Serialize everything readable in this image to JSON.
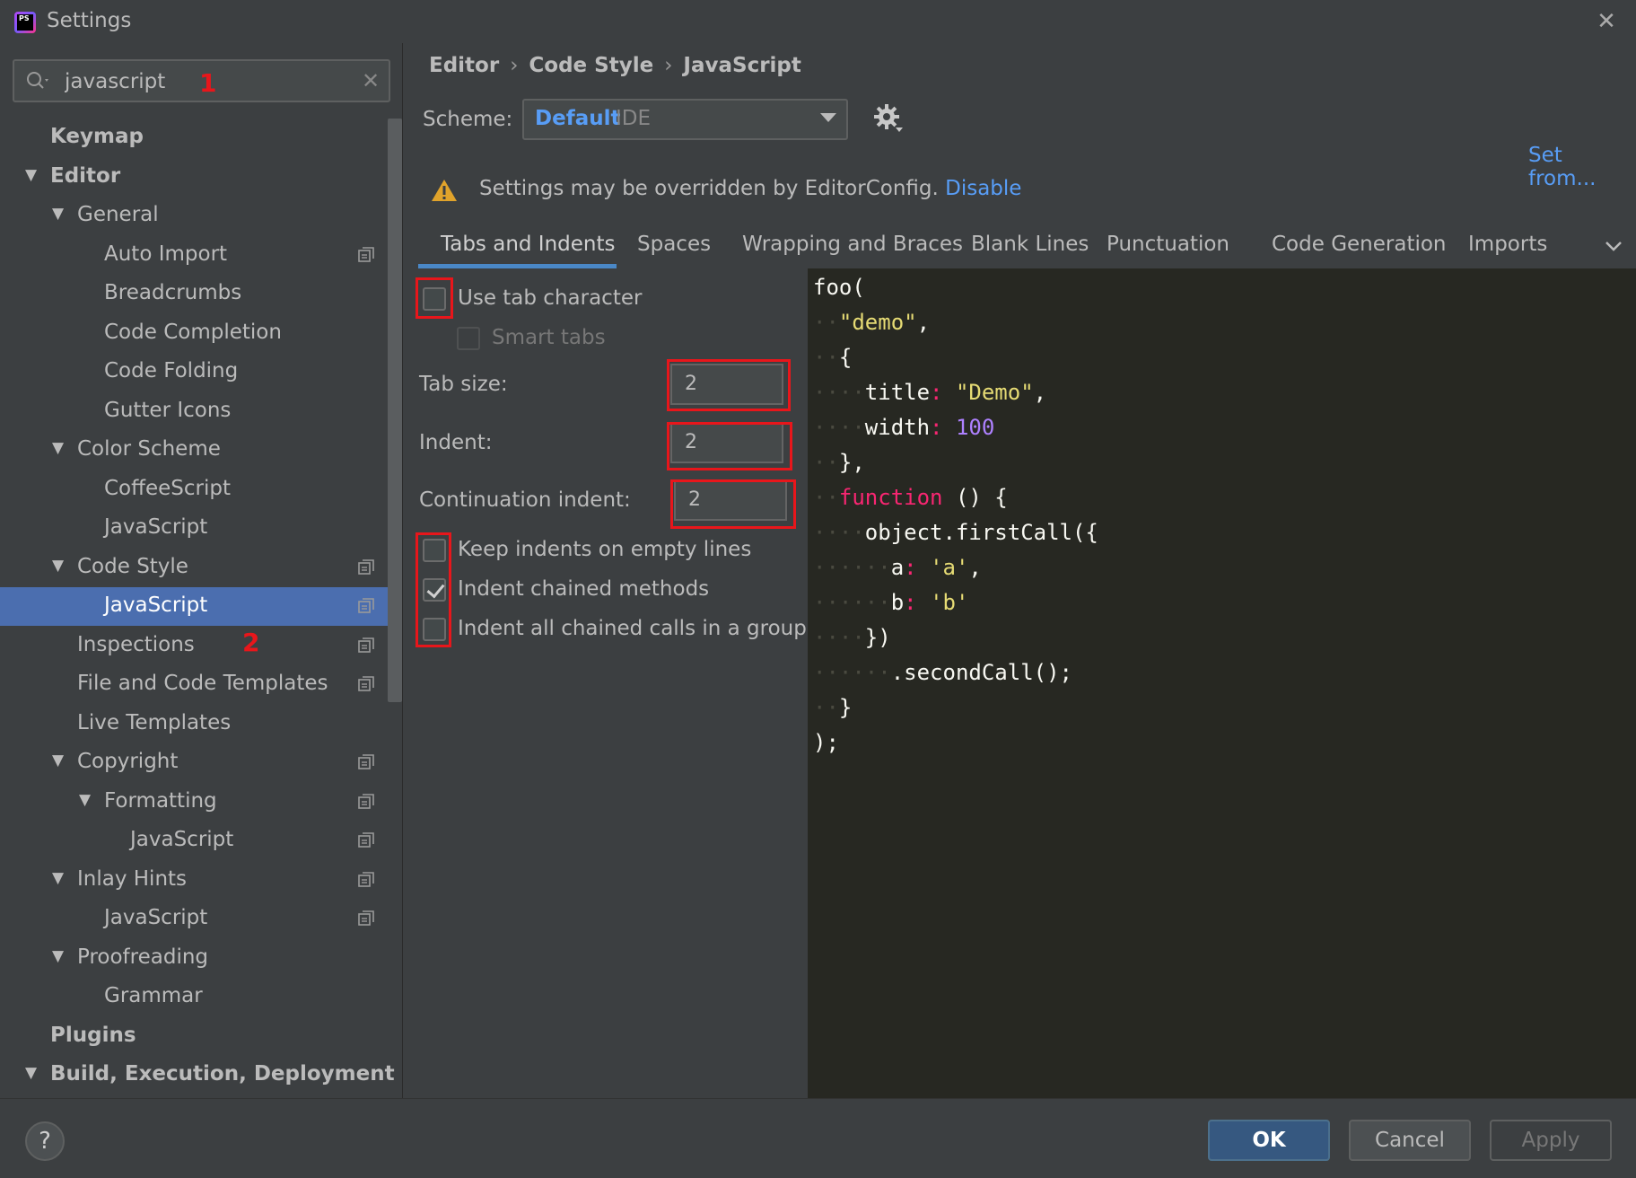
{
  "window": {
    "title": "Settings"
  },
  "search": {
    "value": "javascript",
    "annotation": "1"
  },
  "sidebar": {
    "selected_annotation": "2",
    "items": [
      {
        "label": "Keymap",
        "level": 0,
        "bold": true,
        "arrow": false,
        "copy": false,
        "selected": false
      },
      {
        "label": "Editor",
        "level": 0,
        "bold": true,
        "arrow": true,
        "copy": false,
        "selected": false
      },
      {
        "label": "General",
        "level": 1,
        "bold": false,
        "arrow": true,
        "copy": false,
        "selected": false
      },
      {
        "label": "Auto Import",
        "level": 2,
        "bold": false,
        "arrow": false,
        "copy": true,
        "selected": false
      },
      {
        "label": "Breadcrumbs",
        "level": 2,
        "bold": false,
        "arrow": false,
        "copy": false,
        "selected": false
      },
      {
        "label": "Code Completion",
        "level": 2,
        "bold": false,
        "arrow": false,
        "copy": false,
        "selected": false
      },
      {
        "label": "Code Folding",
        "level": 2,
        "bold": false,
        "arrow": false,
        "copy": false,
        "selected": false
      },
      {
        "label": "Gutter Icons",
        "level": 2,
        "bold": false,
        "arrow": false,
        "copy": false,
        "selected": false
      },
      {
        "label": "Color Scheme",
        "level": 1,
        "bold": false,
        "arrow": true,
        "copy": false,
        "selected": false
      },
      {
        "label": "CoffeeScript",
        "level": 2,
        "bold": false,
        "arrow": false,
        "copy": false,
        "selected": false
      },
      {
        "label": "JavaScript",
        "level": 2,
        "bold": false,
        "arrow": false,
        "copy": false,
        "selected": false
      },
      {
        "label": "Code Style",
        "level": 1,
        "bold": false,
        "arrow": true,
        "copy": true,
        "selected": false
      },
      {
        "label": "JavaScript",
        "level": 2,
        "bold": false,
        "arrow": false,
        "copy": true,
        "selected": true
      },
      {
        "label": "Inspections",
        "level": 1,
        "bold": false,
        "arrow": false,
        "copy": true,
        "selected": false
      },
      {
        "label": "File and Code Templates",
        "level": 1,
        "bold": false,
        "arrow": false,
        "copy": true,
        "selected": false
      },
      {
        "label": "Live Templates",
        "level": 1,
        "bold": false,
        "arrow": false,
        "copy": false,
        "selected": false
      },
      {
        "label": "Copyright",
        "level": 1,
        "bold": false,
        "arrow": true,
        "copy": true,
        "selected": false
      },
      {
        "label": "Formatting",
        "level": 2,
        "bold": false,
        "arrow": true,
        "copy": true,
        "selected": false
      },
      {
        "label": "JavaScript",
        "level": 3,
        "bold": false,
        "arrow": false,
        "copy": true,
        "selected": false
      },
      {
        "label": "Inlay Hints",
        "level": 1,
        "bold": false,
        "arrow": true,
        "copy": true,
        "selected": false
      },
      {
        "label": "JavaScript",
        "level": 2,
        "bold": false,
        "arrow": false,
        "copy": true,
        "selected": false
      },
      {
        "label": "Proofreading",
        "level": 1,
        "bold": false,
        "arrow": true,
        "copy": false,
        "selected": false
      },
      {
        "label": "Grammar",
        "level": 2,
        "bold": false,
        "arrow": false,
        "copy": false,
        "selected": false
      },
      {
        "label": "Plugins",
        "level": 0,
        "bold": true,
        "arrow": false,
        "copy": false,
        "selected": false
      },
      {
        "label": "Build, Execution, Deployment",
        "level": 0,
        "bold": true,
        "arrow": true,
        "copy": false,
        "selected": false
      }
    ]
  },
  "breadcrumb": {
    "items": [
      "Editor",
      "Code Style",
      "JavaScript"
    ],
    "separator": "›"
  },
  "scheme": {
    "label": "Scheme:",
    "name": "Default",
    "sub": "IDE"
  },
  "set_from": "Set from...",
  "warning": {
    "text": "Settings may be overridden by EditorConfig.",
    "link": "Disable"
  },
  "tabs": [
    {
      "label": "Tabs and Indents",
      "active": true
    },
    {
      "label": "Spaces",
      "active": false
    },
    {
      "label": "Wrapping and Braces",
      "active": false
    },
    {
      "label": "Blank Lines",
      "active": false
    },
    {
      "label": "Punctuation",
      "active": false
    },
    {
      "label": "Code Generation",
      "active": false
    },
    {
      "label": "Imports",
      "active": false
    }
  ],
  "options": {
    "use_tab": {
      "label": "Use tab character",
      "checked": false
    },
    "smart_tabs": {
      "label": "Smart tabs",
      "checked": false
    },
    "tab_size": {
      "label": "Tab size:",
      "value": "2"
    },
    "indent": {
      "label": "Indent:",
      "value": "2"
    },
    "continuation": {
      "label": "Continuation indent:",
      "value": "2"
    },
    "keep_indents": {
      "label": "Keep indents on empty lines",
      "checked": false
    },
    "indent_chained": {
      "label": "Indent chained methods",
      "checked": true
    },
    "indent_all_chained": {
      "label": "Indent all chained calls in a group",
      "checked": false
    }
  },
  "code_preview": [
    [
      [
        "",
        "foo("
      ]
    ],
    [
      [
        "ws",
        "··"
      ],
      [
        "str",
        "\"demo\""
      ],
      [
        "",
        ","
      ]
    ],
    [
      [
        "ws",
        "··"
      ],
      [
        "",
        "{"
      ]
    ],
    [
      [
        "ws",
        "····"
      ],
      [
        "",
        "title"
      ],
      [
        "pn",
        ":"
      ],
      [
        "",
        " "
      ],
      [
        "str",
        "\"Demo\""
      ],
      [
        "",
        ","
      ]
    ],
    [
      [
        "ws",
        "····"
      ],
      [
        "",
        "width"
      ],
      [
        "pn",
        ":"
      ],
      [
        "",
        " "
      ],
      [
        "num",
        "100"
      ]
    ],
    [
      [
        "ws",
        "··"
      ],
      [
        "",
        "},"
      ]
    ],
    [
      [
        "ws",
        "··"
      ],
      [
        "kw",
        "function"
      ],
      [
        "",
        " () {"
      ]
    ],
    [
      [
        "ws",
        "····"
      ],
      [
        "",
        "object.firstCall({"
      ]
    ],
    [
      [
        "ws",
        "······"
      ],
      [
        "",
        "a"
      ],
      [
        "pn",
        ":"
      ],
      [
        "",
        " "
      ],
      [
        "str",
        "'a'"
      ],
      [
        "",
        ","
      ]
    ],
    [
      [
        "ws",
        "······"
      ],
      [
        "",
        "b"
      ],
      [
        "pn",
        ":"
      ],
      [
        "",
        " "
      ],
      [
        "str",
        "'b'"
      ]
    ],
    [
      [
        "ws",
        "····"
      ],
      [
        "",
        "})"
      ]
    ],
    [
      [
        "ws",
        "······"
      ],
      [
        "",
        ".secondCall();"
      ]
    ],
    [
      [
        "ws",
        "··"
      ],
      [
        "",
        "}"
      ]
    ],
    [
      [
        "",
        ");"
      ]
    ]
  ],
  "buttons": {
    "ok": "OK",
    "cancel": "Cancel",
    "apply": "Apply",
    "help": "?"
  }
}
